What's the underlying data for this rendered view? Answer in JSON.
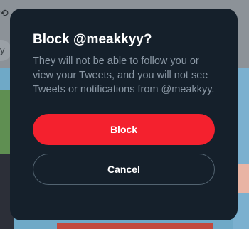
{
  "backdrop": {
    "search_fragment": "y"
  },
  "dialog": {
    "title": "Block @meakkyy?",
    "description": "They will not be able to follow you or view your Tweets, and you will not see Tweets or notifications from @meakkyy.",
    "block_label": "Block",
    "cancel_label": "Cancel"
  },
  "colors": {
    "dialog_bg": "#15202b",
    "danger": "#f4212e",
    "muted_text": "#8b98a5",
    "outline": "#536471"
  }
}
